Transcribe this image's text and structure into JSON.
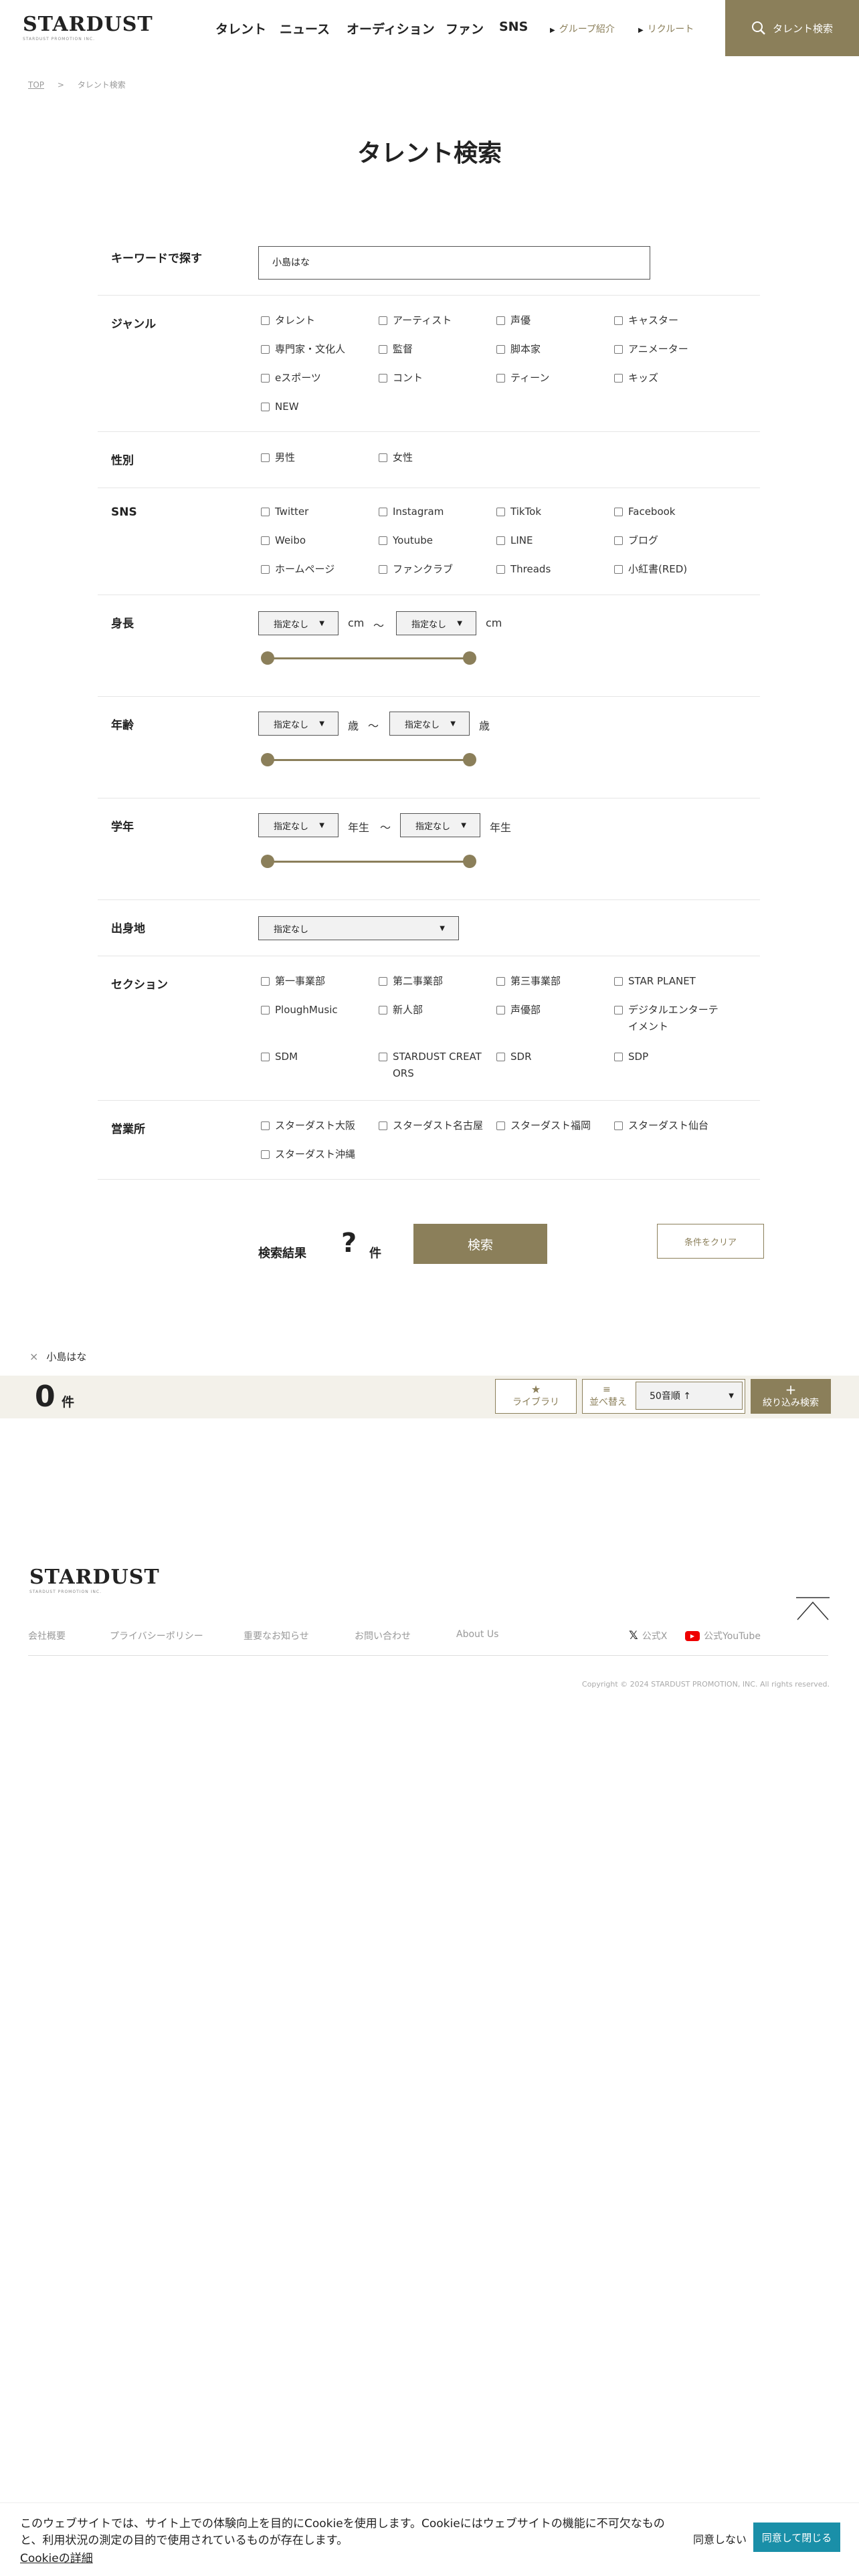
{
  "header": {
    "logo": "STARDUST",
    "logo_sub": "STARDUST PROMOTION INC.",
    "nav": [
      "タレント",
      "ニュース",
      "オーディション",
      "ファン",
      "SNS"
    ],
    "group": "グループ紹介",
    "recruit": "リクルート",
    "search": "タレント検索"
  },
  "breadcrumb": {
    "top": "TOP",
    "sep": ">",
    "current": "タレント検索"
  },
  "page_title": "タレント検索",
  "keyword": {
    "label": "キーワードで探す",
    "value": "小島はな"
  },
  "genre": {
    "label": "ジャンル",
    "items": [
      "タレント",
      "アーティスト",
      "声優",
      "キャスター",
      "専門家・文化人",
      "監督",
      "脚本家",
      "アニメーター",
      "eスポーツ",
      "コント",
      "ティーン",
      "キッズ",
      "NEW"
    ]
  },
  "gender": {
    "label": "性別",
    "items": [
      "男性",
      "女性"
    ]
  },
  "sns": {
    "label": "SNS",
    "items": [
      "Twitter",
      "Instagram",
      "TikTok",
      "Facebook",
      "Weibo",
      "Youtube",
      "LINE",
      "ブログ",
      "ホームページ",
      "ファンクラブ",
      "Threads",
      "小紅書(RED)"
    ]
  },
  "height": {
    "label": "身長",
    "from": "指定なし",
    "to": "指定なし",
    "unit": "cm",
    "tilde": "〜"
  },
  "age": {
    "label": "年齢",
    "from": "指定なし",
    "to": "指定なし",
    "unit": "歳",
    "tilde": "〜"
  },
  "grade": {
    "label": "学年",
    "from": "指定なし",
    "to": "指定なし",
    "unit": "年生",
    "tilde": "〜"
  },
  "birthplace": {
    "label": "出身地",
    "value": "指定なし"
  },
  "section": {
    "label": "セクション",
    "items": [
      "第一事業部",
      "第二事業部",
      "第三事業部",
      "STAR PLANET",
      "PloughMusic",
      "新人部",
      "声優部",
      "デジタルエンターテイメント",
      "SDM",
      "STARDUST CREATORS",
      "SDR",
      "SDP"
    ]
  },
  "office": {
    "label": "営業所",
    "items": [
      "スターダスト大阪",
      "スターダスト名古屋",
      "スターダスト福岡",
      "スターダスト仙台",
      "スターダスト沖縄"
    ]
  },
  "result": {
    "label": "検索結果",
    "count": "?",
    "unit": "件",
    "search": "検索",
    "clear": "条件をクリア"
  },
  "chip": {
    "close": "×",
    "text": "小島はな"
  },
  "bar": {
    "count": "0",
    "unit": "件",
    "library": "ライブラリ",
    "sort_label": "並べ替え",
    "sort_value": "50音順 ↑",
    "filter": "絞り込み検索"
  },
  "footer": {
    "logo": "STARDUST",
    "logo_sub": "STARDUST PROMOTION INC.",
    "links": [
      "会社概要",
      "プライバシーポリシー",
      "重要なお知らせ",
      "お問い合わせ",
      "About Us"
    ],
    "x": "公式X",
    "youtube": "公式YouTube",
    "copyright": "Copyright © 2024 STARDUST PROMOTION, INC. All rights reserved."
  },
  "cookie": {
    "text": "このウェブサイトでは、サイト上での体験向上を目的にCookieを使用します。Cookieにはウェブサイトの機能に不可欠なものと、利用状況の測定の目的で使用されているものが存在します。",
    "link": "Cookieの詳細",
    "decline": "同意しない",
    "accept": "同意して閉じる"
  },
  "colors": {
    "accent": "#8b7f5a",
    "cookie_btn": "#1a8fa8"
  }
}
